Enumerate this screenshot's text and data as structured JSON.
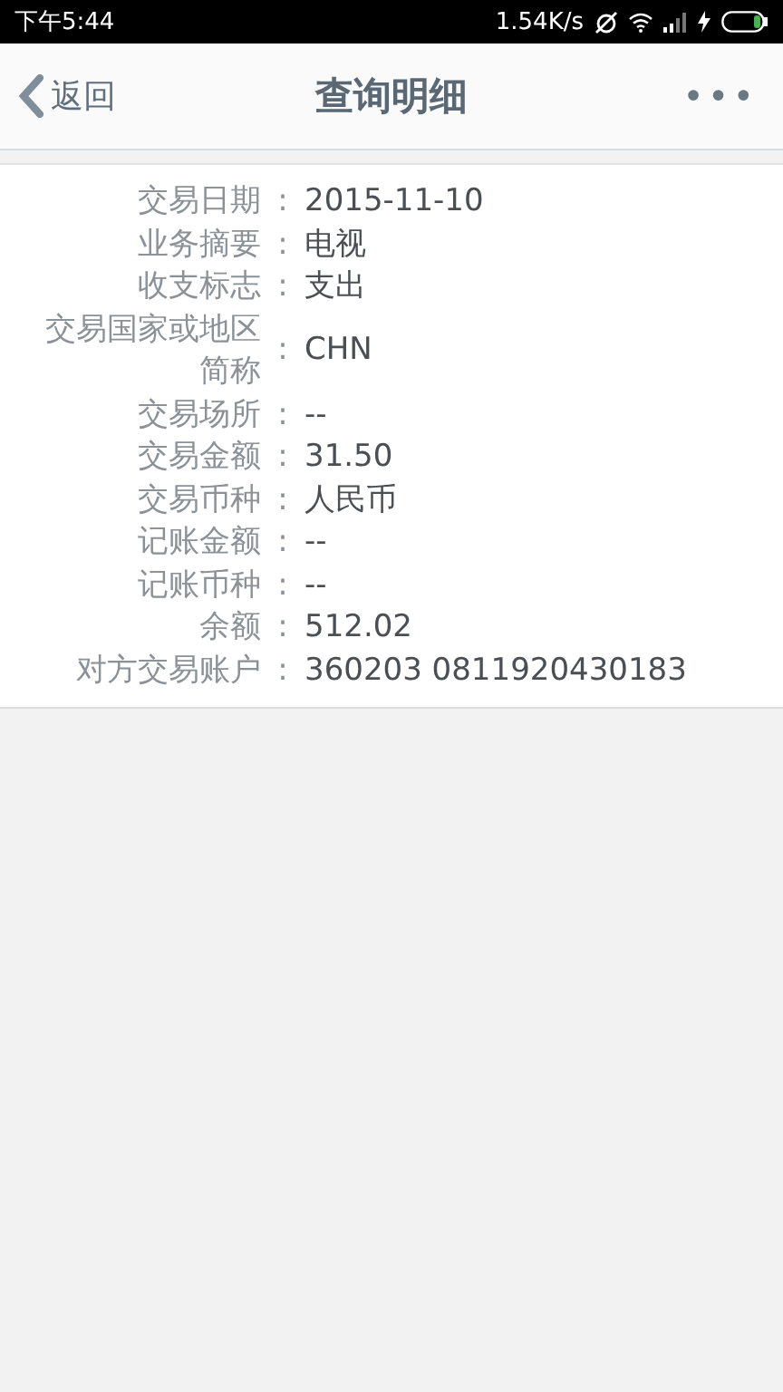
{
  "status_bar": {
    "time": "下午5:44",
    "speed": "1.54K/s"
  },
  "header": {
    "back": "返回",
    "title": "查询明细",
    "more": "•••"
  },
  "details": [
    {
      "label": "交易日期",
      "separator": ":",
      "value": "2015-11-10"
    },
    {
      "label": "业务摘要",
      "separator": ":",
      "value": "电视"
    },
    {
      "label": "收支标志",
      "separator": ":",
      "value": "支出"
    },
    {
      "label": "交易国家或地区简称",
      "separator": ":",
      "value": "CHN"
    },
    {
      "label": "交易场所",
      "separator": ":",
      "value": "--"
    },
    {
      "label": "交易金额",
      "separator": ":",
      "value": "31.50"
    },
    {
      "label": "交易币种",
      "separator": ":",
      "value": "人民币"
    },
    {
      "label": "记账金额",
      "separator": ":",
      "value": "--"
    },
    {
      "label": "记账币种",
      "separator": ":",
      "value": "--"
    },
    {
      "label": "余额",
      "separator": ":",
      "value": "512.02"
    },
    {
      "label": "对方交易账户",
      "separator": ":",
      "value": "360203 0811920430183"
    }
  ]
}
